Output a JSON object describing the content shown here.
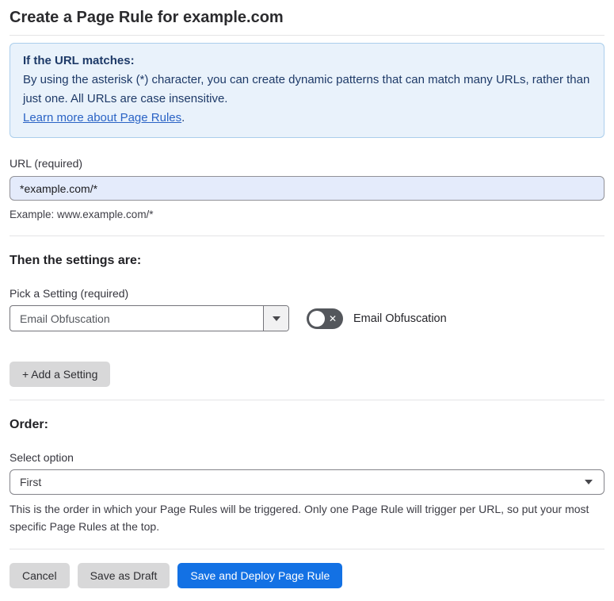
{
  "page": {
    "title": "Create a Page Rule for example.com"
  },
  "info_box": {
    "heading": "If the URL matches:",
    "body": "By using the asterisk (*) character, you can create dynamic patterns that can match many URLs, rather than just one. All URLs are case insensitive.",
    "link_label": "Learn more about Page Rules",
    "link_suffix": "."
  },
  "url_field": {
    "label": "URL (required)",
    "value": "*example.com/*",
    "helper": "Example: www.example.com/*"
  },
  "settings_section": {
    "heading": "Then the settings are:",
    "picker_label": "Pick a Setting (required)",
    "picker_value": "Email Obfuscation",
    "toggle_label": "Email Obfuscation",
    "toggle_state": "off",
    "add_setting_label": "+ Add a Setting"
  },
  "order_section": {
    "heading": "Order:",
    "select_label": "Select option",
    "select_value": "First",
    "helper": "This is the order in which your Page Rules will be triggered. Only one Page Rule will trigger per URL, so put your most specific Page Rules at the top."
  },
  "footer": {
    "cancel_label": "Cancel",
    "save_draft_label": "Save as Draft",
    "save_deploy_label": "Save and Deploy Page Rule"
  },
  "colors": {
    "accent_blue": "#1371e4",
    "info_background": "#e9f2fb",
    "info_border": "#abceec",
    "info_text": "#1e3a68",
    "link_blue": "#2a63c5",
    "url_input_background": "#e4ebfb",
    "toggle_off_background": "#54575c",
    "gray_button_background": "#d8d8d9"
  }
}
